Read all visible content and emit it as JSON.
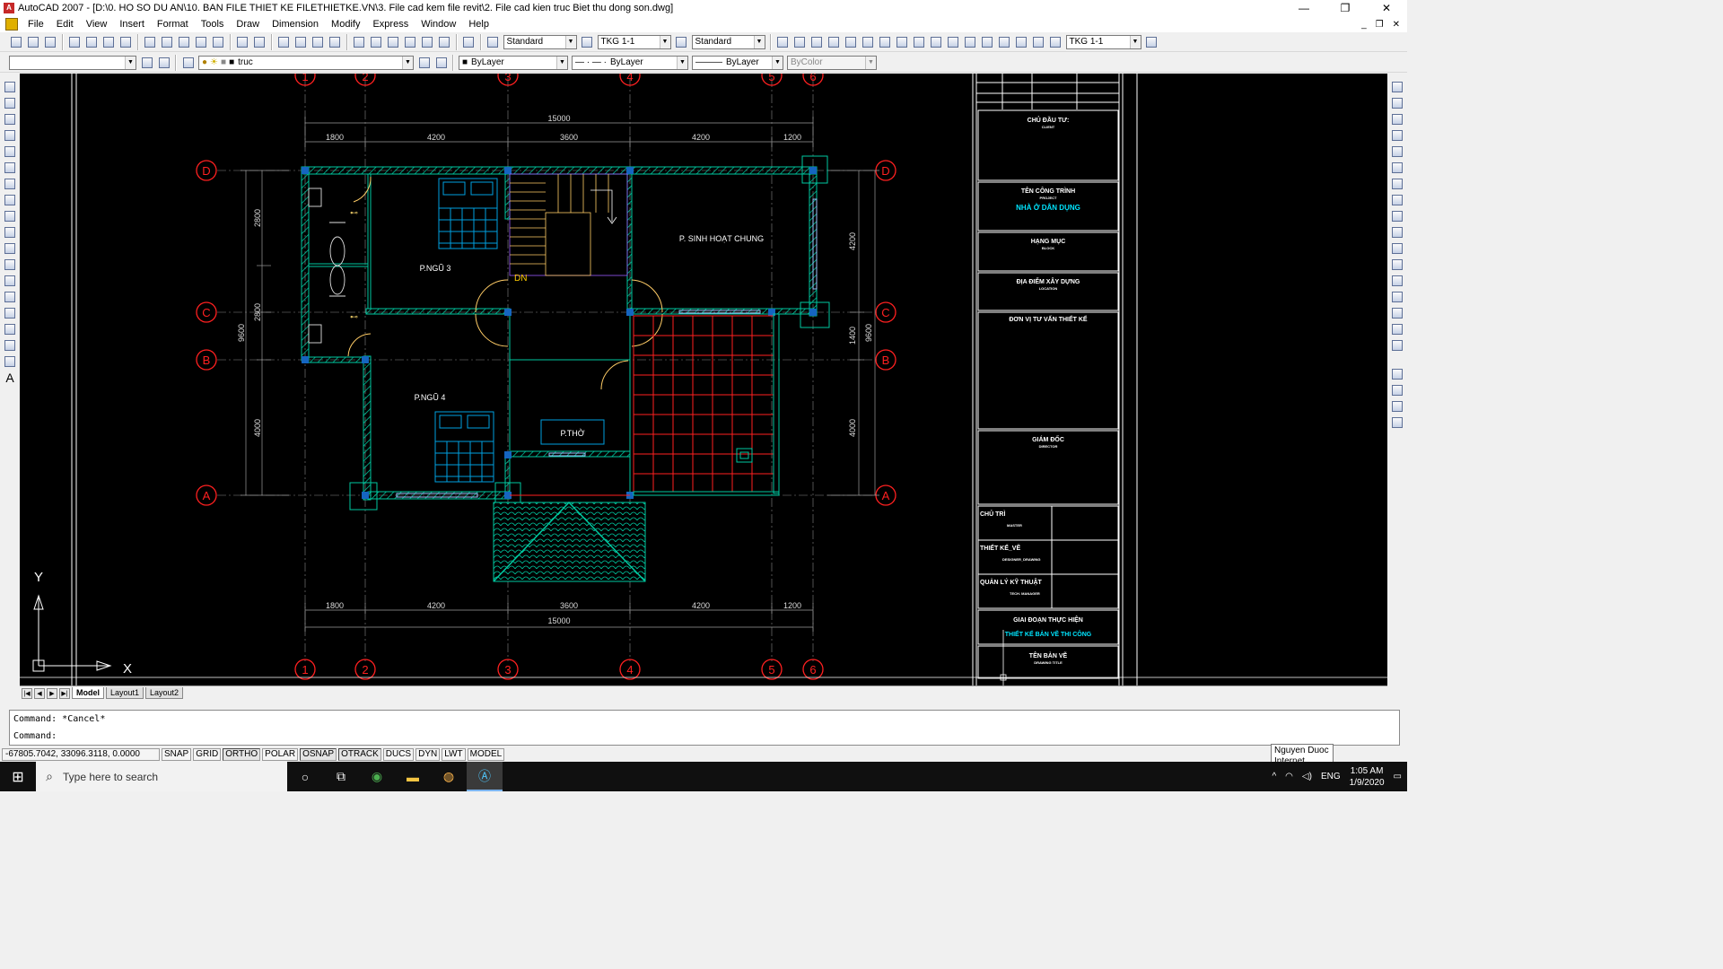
{
  "window": {
    "title": "AutoCAD 2007 - [D:\\0. HO SO DU AN\\10. BAN FILE THIET KE FILETHIETKE.VN\\3. File cad kem file revit\\2. File cad kien truc Biet thu dong son.dwg]",
    "minimize": "—",
    "restore": "❐",
    "close": "✕"
  },
  "menu": {
    "items": [
      "File",
      "Edit",
      "View",
      "Insert",
      "Format",
      "Tools",
      "Draw",
      "Dimension",
      "Modify",
      "Express",
      "Window",
      "Help"
    ],
    "doc_minimize": "_",
    "doc_restore": "❐",
    "doc_close": "✕"
  },
  "toolbar1": {
    "text_style": "Standard",
    "dim_style": "TKG 1-1",
    "table_style": "Standard",
    "dim_style2": "TKG 1-1"
  },
  "toolbar2": {
    "workspace": "",
    "layer": "truc",
    "color": "ByLayer",
    "linetype": "ByLayer",
    "lineweight": "ByLayer",
    "plotstyle": "ByColor"
  },
  "drawing": {
    "grid_cols": [
      "1",
      "2",
      "3",
      "4",
      "5",
      "6"
    ],
    "grid_rows": [
      "D",
      "C",
      "B",
      "A"
    ],
    "dim_total": "15000",
    "dim_spans": [
      "1800",
      "4200",
      "3600",
      "4200",
      "1200"
    ],
    "dim_left": [
      "2800",
      "2800",
      "4000"
    ],
    "dim_left_total": "9600",
    "dim_right": [
      "4200",
      "1400",
      "4000"
    ],
    "dim_right_total": "9600",
    "rooms": {
      "bed3": "P.NGŨ 3",
      "bed4": "P.NGŨ 4",
      "living": "P. SINH HOẠT CHUNG",
      "worship": "P.THỜ",
      "stair_dn": "DN"
    },
    "ucs_x": "X",
    "ucs_y": "Y"
  },
  "titleblock": {
    "owner": "CHỦ ĐẦU TƯ:",
    "owner_en": "CLIENT",
    "project": "TÊN CÔNG TRÌNH",
    "project_en": "PROJECT",
    "project_name": "NHÀ Ở DÂN DỤNG",
    "item": "HẠNG MỤC",
    "item_en": "BLOCK",
    "location": "ĐỊA ĐIỂM XÂY DỰNG",
    "location_en": "LOCATION",
    "consultant": "ĐƠN VỊ TƯ VẤN THIẾT KẾ",
    "director": "GIÁM ĐỐC",
    "director_en": "DIRECTOR",
    "chief": "CHỦ TRÌ",
    "chief_en": "MASTER",
    "designer": "THIẾT KẾ_VẼ",
    "designer_en": "DESIGNER_DRAWING",
    "manager": "QUẢN LÝ KỸ THUẬT",
    "manager_en": "TECH. MANAGER",
    "phase": "GIAI ĐOẠN THỰC HIỆN",
    "phase_value": "THIẾT KẾ BẢN VẼ THI CÔNG",
    "drawing_name": "TÊN BẢN VẼ",
    "drawing_name_en": "DRAWING TITLE"
  },
  "layout_tabs": [
    "Model",
    "Layout1",
    "Layout2"
  ],
  "command": {
    "line1": "Command: *Cancel*",
    "line2": "Command:"
  },
  "status": {
    "coords": "-67805.7042, 33096.3118, 0.0000",
    "toggles": [
      "SNAP",
      "GRID",
      "ORTHO",
      "POLAR",
      "OSNAP",
      "OTRACK",
      "DUCS",
      "DYN",
      "LWT",
      "MODEL"
    ]
  },
  "tooltip": {
    "line1": "Nguyen Duoc",
    "line2": "Internet access"
  },
  "taskbar": {
    "search_placeholder": "Type here to search",
    "lang": "ENG",
    "time": "1:05 AM",
    "date": "1/9/2020"
  },
  "colors": {
    "canvas": "#000000",
    "grid_bubble": "#ff2020",
    "wall": "#00c8a0",
    "text": "#ffffff",
    "furniture": "#00a0e0",
    "tile": "#ff2020",
    "roof": "#00c8a0"
  }
}
